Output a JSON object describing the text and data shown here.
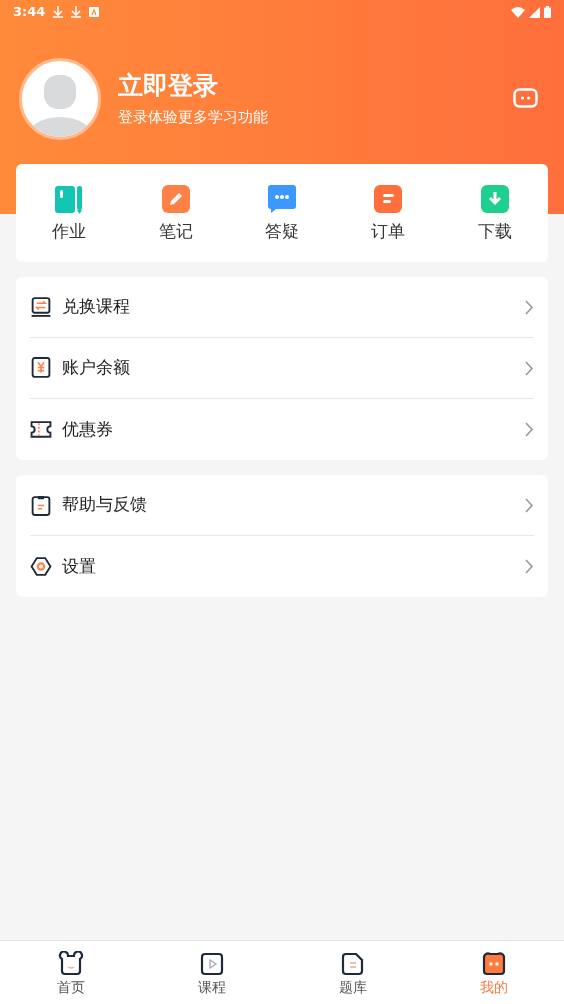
{
  "status_bar": {
    "time": "3:44"
  },
  "header": {
    "title": "立即登录",
    "subtitle": "登录体验更多学习功能"
  },
  "quick_actions": [
    {
      "label": "作业",
      "kind": "homework"
    },
    {
      "label": "笔记",
      "kind": "notes"
    },
    {
      "label": "答疑",
      "kind": "qa"
    },
    {
      "label": "订单",
      "kind": "orders"
    },
    {
      "label": "下载",
      "kind": "download"
    }
  ],
  "menu_groups": [
    {
      "items": [
        {
          "label": "兑换课程",
          "kind": "exchange"
        },
        {
          "label": "账户余额",
          "kind": "balance"
        },
        {
          "label": "优惠券",
          "kind": "coupon"
        }
      ]
    },
    {
      "items": [
        {
          "label": "帮助与反馈",
          "kind": "help"
        },
        {
          "label": "设置",
          "kind": "settings"
        }
      ]
    }
  ],
  "tabs": [
    {
      "label": "首页",
      "kind": "home",
      "selected": false
    },
    {
      "label": "课程",
      "kind": "course",
      "selected": false
    },
    {
      "label": "题库",
      "kind": "bank",
      "selected": false
    },
    {
      "label": "我的",
      "kind": "mine",
      "selected": true
    }
  ]
}
